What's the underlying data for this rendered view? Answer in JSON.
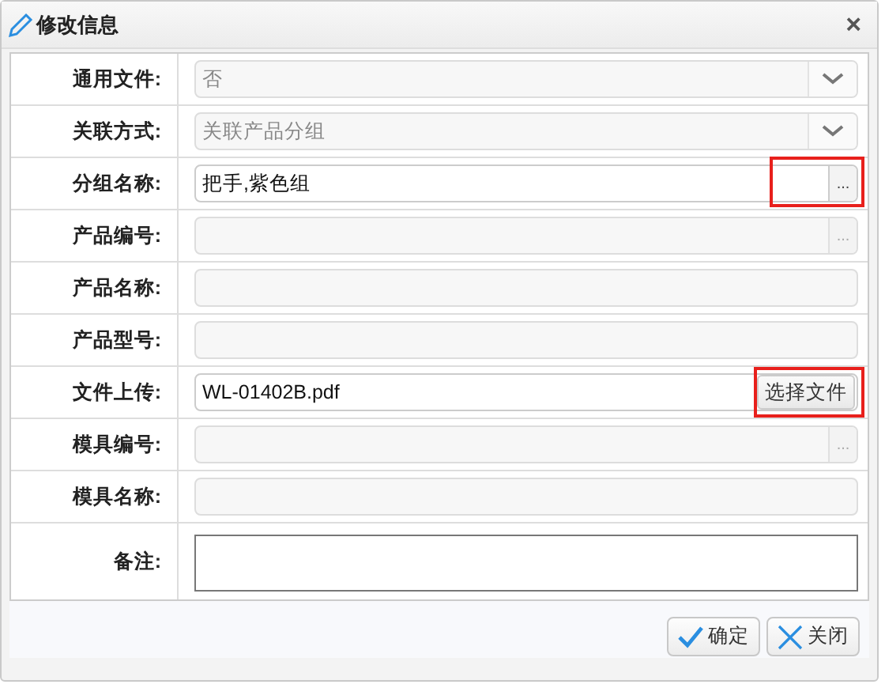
{
  "window": {
    "title": "修改信息",
    "close": "×"
  },
  "rows": [
    {
      "label": "通用文件:",
      "kind": "select",
      "value": "否",
      "disabled": true,
      "highlighted": false
    },
    {
      "label": "关联方式:",
      "kind": "select",
      "value": "关联产品分组",
      "disabled": true,
      "highlighted": false
    },
    {
      "label": "分组名称:",
      "kind": "picker",
      "value": "把手,紫色组",
      "button": "...",
      "disabled": false,
      "highlighted": true
    },
    {
      "label": "产品编号:",
      "kind": "picker",
      "button": "...",
      "disabled": true,
      "highlighted": false
    },
    {
      "label": "产品名称:",
      "kind": "text",
      "disabled": true,
      "highlighted": false
    },
    {
      "label": "产品型号:",
      "kind": "text",
      "disabled": true,
      "highlighted": false
    },
    {
      "label": "文件上传:",
      "kind": "file",
      "value": "WL-01402B.pdf",
      "button": "选择文件",
      "disabled": false,
      "highlighted": true
    },
    {
      "label": "模具编号:",
      "kind": "picker",
      "button": "...",
      "disabled": true,
      "highlighted": false
    },
    {
      "label": "模具名称:",
      "kind": "text",
      "disabled": true,
      "highlighted": false
    },
    {
      "label": "备注:",
      "kind": "textarea",
      "disabled": false,
      "highlighted": false
    }
  ],
  "buttons": [
    {
      "label": "确定",
      "kind": "ok"
    },
    {
      "label": "关闭",
      "kind": "close"
    }
  ]
}
